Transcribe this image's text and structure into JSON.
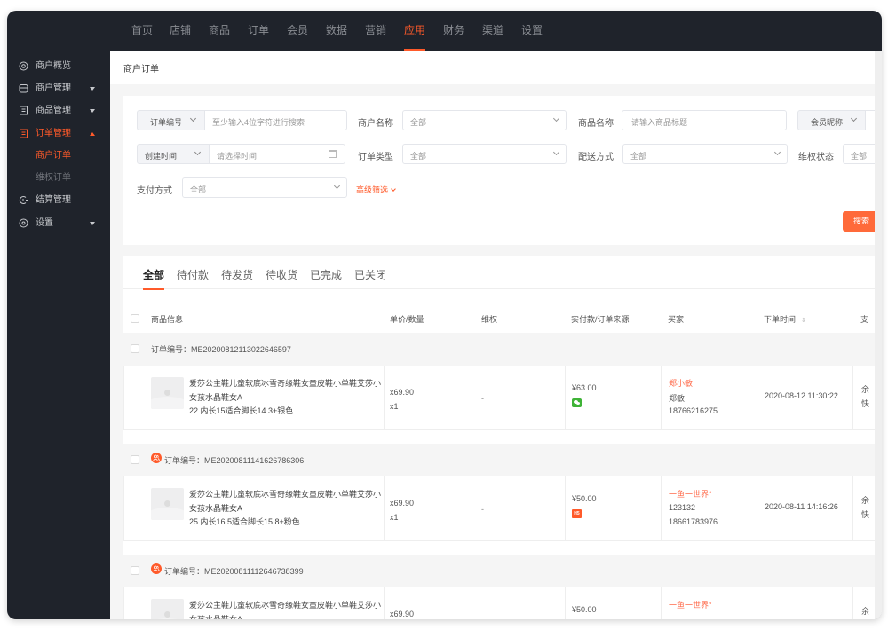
{
  "topnav": {
    "items": [
      "首页",
      "店铺",
      "商品",
      "订单",
      "会员",
      "数据",
      "营销",
      "应用",
      "财务",
      "渠道",
      "设置"
    ],
    "active_index": 7
  },
  "sidebar": {
    "items": [
      {
        "label": "商户概览",
        "icon": "dashboard-icon"
      },
      {
        "label": "商户管理",
        "icon": "store-icon"
      },
      {
        "label": "商品管理",
        "icon": "goods-icon"
      },
      {
        "label": "订单管理",
        "icon": "order-icon"
      },
      {
        "label": "商户订单",
        "icon": ""
      },
      {
        "label": "维权订单",
        "icon": ""
      },
      {
        "label": "结算管理",
        "icon": "settlement-icon"
      },
      {
        "label": "设置",
        "icon": "settings-icon"
      }
    ]
  },
  "page": {
    "title": "商户订单"
  },
  "filters": {
    "order_no_prefix": "订单编号",
    "order_no_placeholder": "至少输入4位字符进行搜索",
    "merchant_label": "商户名称",
    "merchant_value": "全部",
    "product_label": "商品名称",
    "product_placeholder": "请输入商品标题",
    "member_prefix": "会员昵称",
    "time_prefix": "创建时间",
    "time_placeholder": "请选择时间",
    "order_type_label": "订单类型",
    "order_type_value": "全部",
    "delivery_label": "配送方式",
    "delivery_value": "全部",
    "rights_label": "维权状态",
    "rights_value": "全部",
    "pay_label": "支付方式",
    "pay_value": "全部",
    "advanced_label": "高级筛选",
    "search_label": "搜索"
  },
  "tabs": [
    "全部",
    "待付款",
    "待发货",
    "待收货",
    "已完成",
    "已关闭"
  ],
  "table": {
    "headers": {
      "product": "商品信息",
      "price_qty": "单价/数量",
      "rights": "维权",
      "paid_source": "实付款/订单来源",
      "buyer": "买家",
      "order_time": "下单时间",
      "pay": "支"
    },
    "orders": [
      {
        "order_no": "订单编号：ME20200812113022646597",
        "product_name": "爱莎公主鞋儿童软底冰雪奇缘鞋女童皮鞋小单鞋艾莎小女孩水晶鞋女A",
        "sku": "22 内长15适合脚长14.3+银色",
        "unit_price": "x69.90",
        "qty": "x1",
        "rights": "-",
        "paid": "¥63.00",
        "source": "wechat",
        "buyer_nick": "郑小敏",
        "buyer_name": "郑敏",
        "buyer_phone": "18766216275",
        "order_time": "2020-08-12 11:30:22",
        "pay_line1": "余",
        "pay_line2": "快"
      },
      {
        "order_no": "订单编号：ME20200811141626786306",
        "product_name": "爱莎公主鞋儿童软底冰雪奇缘鞋女童皮鞋小单鞋艾莎小女孩水晶鞋女A",
        "sku": "25 内长16.5适合脚长15.8+粉色",
        "unit_price": "x69.90",
        "qty": "x1",
        "rights": "-",
        "paid": "¥50.00",
        "source": "H5",
        "buyer_nick": "一鱼一世界°",
        "buyer_name": "123132",
        "buyer_phone": "18661783976",
        "order_time": "2020-08-11 14:16:26",
        "pay_line1": "余",
        "pay_line2": "快"
      },
      {
        "order_no": "订单编号：ME20200811112646738399",
        "product_name": "爱莎公主鞋儿童软底冰雪奇缘鞋女童皮鞋小单鞋艾莎小女孩水晶鞋女A",
        "sku": "",
        "unit_price": "x69.90",
        "qty": "",
        "rights": "",
        "paid": "¥50.00",
        "source": "",
        "buyer_nick": "一鱼一世界°",
        "buyer_name": "",
        "buyer_phone": "",
        "order_time": "",
        "pay_line1": "余",
        "pay_line2": ""
      }
    ]
  },
  "colors": {
    "accent": "#ff5a2a",
    "sidebar_bg": "#1f232b",
    "wechat": "#3fb337"
  }
}
